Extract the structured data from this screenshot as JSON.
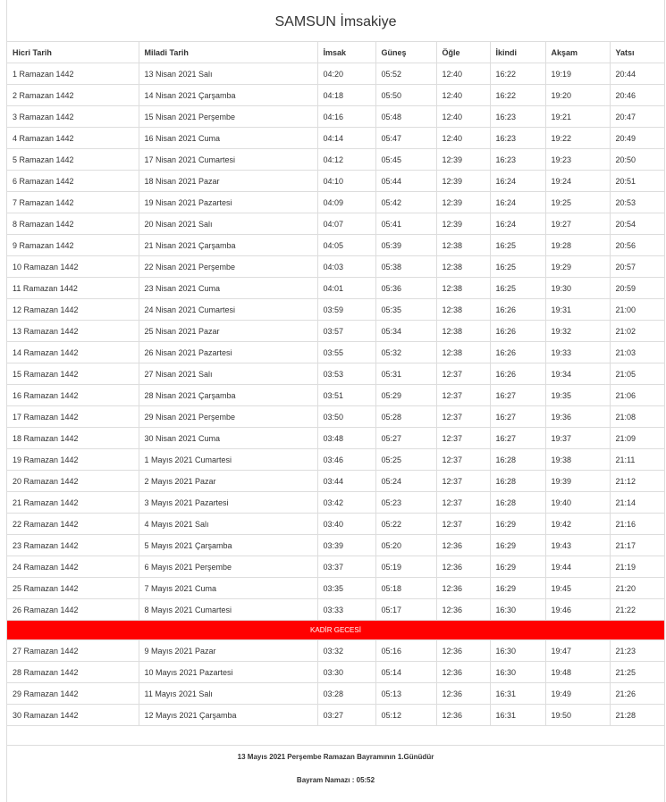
{
  "title": "SAMSUN İmsakiye",
  "headers": [
    "Hicri Tarih",
    "Miladi Tarih",
    "İmsak",
    "Güneş",
    "Öğle",
    "İkindi",
    "Akşam",
    "Yatsı"
  ],
  "rows_a": [
    [
      "1 Ramazan 1442",
      "13 Nisan 2021 Salı",
      "04:20",
      "05:52",
      "12:40",
      "16:22",
      "19:19",
      "20:44"
    ],
    [
      "2 Ramazan 1442",
      "14 Nisan 2021 Çarşamba",
      "04:18",
      "05:50",
      "12:40",
      "16:22",
      "19:20",
      "20:46"
    ],
    [
      "3 Ramazan 1442",
      "15 Nisan 2021 Perşembe",
      "04:16",
      "05:48",
      "12:40",
      "16:23",
      "19:21",
      "20:47"
    ],
    [
      "4 Ramazan 1442",
      "16 Nisan 2021 Cuma",
      "04:14",
      "05:47",
      "12:40",
      "16:23",
      "19:22",
      "20:49"
    ],
    [
      "5 Ramazan 1442",
      "17 Nisan 2021 Cumartesi",
      "04:12",
      "05:45",
      "12:39",
      "16:23",
      "19:23",
      "20:50"
    ],
    [
      "6 Ramazan 1442",
      "18 Nisan 2021 Pazar",
      "04:10",
      "05:44",
      "12:39",
      "16:24",
      "19:24",
      "20:51"
    ],
    [
      "7 Ramazan 1442",
      "19 Nisan 2021 Pazartesi",
      "04:09",
      "05:42",
      "12:39",
      "16:24",
      "19:25",
      "20:53"
    ],
    [
      "8 Ramazan 1442",
      "20 Nisan 2021 Salı",
      "04:07",
      "05:41",
      "12:39",
      "16:24",
      "19:27",
      "20:54"
    ],
    [
      "9 Ramazan 1442",
      "21 Nisan 2021 Çarşamba",
      "04:05",
      "05:39",
      "12:38",
      "16:25",
      "19:28",
      "20:56"
    ],
    [
      "10 Ramazan 1442",
      "22 Nisan 2021 Perşembe",
      "04:03",
      "05:38",
      "12:38",
      "16:25",
      "19:29",
      "20:57"
    ],
    [
      "11 Ramazan 1442",
      "23 Nisan 2021 Cuma",
      "04:01",
      "05:36",
      "12:38",
      "16:25",
      "19:30",
      "20:59"
    ],
    [
      "12 Ramazan 1442",
      "24 Nisan 2021 Cumartesi",
      "03:59",
      "05:35",
      "12:38",
      "16:26",
      "19:31",
      "21:00"
    ],
    [
      "13 Ramazan 1442",
      "25 Nisan 2021 Pazar",
      "03:57",
      "05:34",
      "12:38",
      "16:26",
      "19:32",
      "21:02"
    ],
    [
      "14 Ramazan 1442",
      "26 Nisan 2021 Pazartesi",
      "03:55",
      "05:32",
      "12:38",
      "16:26",
      "19:33",
      "21:03"
    ],
    [
      "15 Ramazan 1442",
      "27 Nisan 2021 Salı",
      "03:53",
      "05:31",
      "12:37",
      "16:26",
      "19:34",
      "21:05"
    ],
    [
      "16 Ramazan 1442",
      "28 Nisan 2021 Çarşamba",
      "03:51",
      "05:29",
      "12:37",
      "16:27",
      "19:35",
      "21:06"
    ],
    [
      "17 Ramazan 1442",
      "29 Nisan 2021 Perşembe",
      "03:50",
      "05:28",
      "12:37",
      "16:27",
      "19:36",
      "21:08"
    ],
    [
      "18 Ramazan 1442",
      "30 Nisan 2021 Cuma",
      "03:48",
      "05:27",
      "12:37",
      "16:27",
      "19:37",
      "21:09"
    ],
    [
      "19 Ramazan 1442",
      "1 Mayıs 2021 Cumartesi",
      "03:46",
      "05:25",
      "12:37",
      "16:28",
      "19:38",
      "21:11"
    ],
    [
      "20 Ramazan 1442",
      "2 Mayıs 2021 Pazar",
      "03:44",
      "05:24",
      "12:37",
      "16:28",
      "19:39",
      "21:12"
    ],
    [
      "21 Ramazan 1442",
      "3 Mayıs 2021 Pazartesi",
      "03:42",
      "05:23",
      "12:37",
      "16:28",
      "19:40",
      "21:14"
    ],
    [
      "22 Ramazan 1442",
      "4 Mayıs 2021 Salı",
      "03:40",
      "05:22",
      "12:37",
      "16:29",
      "19:42",
      "21:16"
    ],
    [
      "23 Ramazan 1442",
      "5 Mayıs 2021 Çarşamba",
      "03:39",
      "05:20",
      "12:36",
      "16:29",
      "19:43",
      "21:17"
    ],
    [
      "24 Ramazan 1442",
      "6 Mayıs 2021 Perşembe",
      "03:37",
      "05:19",
      "12:36",
      "16:29",
      "19:44",
      "21:19"
    ],
    [
      "25 Ramazan 1442",
      "7 Mayıs 2021 Cuma",
      "03:35",
      "05:18",
      "12:36",
      "16:29",
      "19:45",
      "21:20"
    ],
    [
      "26 Ramazan 1442",
      "8 Mayıs 2021 Cumartesi",
      "03:33",
      "05:17",
      "12:36",
      "16:30",
      "19:46",
      "21:22"
    ]
  ],
  "kadir_label": "KADİR GECESİ",
  "kadir_color": "#ff0000",
  "rows_b": [
    [
      "27 Ramazan 1442",
      "9 Mayıs 2021 Pazar",
      "03:32",
      "05:16",
      "12:36",
      "16:30",
      "19:47",
      "21:23"
    ],
    [
      "28 Ramazan 1442",
      "10 Mayıs 2021 Pazartesi",
      "03:30",
      "05:14",
      "12:36",
      "16:30",
      "19:48",
      "21:25"
    ],
    [
      "29 Ramazan 1442",
      "11 Mayıs 2021 Salı",
      "03:28",
      "05:13",
      "12:36",
      "16:31",
      "19:49",
      "21:26"
    ],
    [
      "30 Ramazan 1442",
      "12 Mayıs 2021 Çarşamba",
      "03:27",
      "05:12",
      "12:36",
      "16:31",
      "19:50",
      "21:28"
    ]
  ],
  "footer": {
    "bayram_note": "13 Mayıs 2021 Perşembe Ramazan Bayramının 1.Günüdür",
    "bayram_namazi": "Bayram Namazı : 05:52"
  }
}
